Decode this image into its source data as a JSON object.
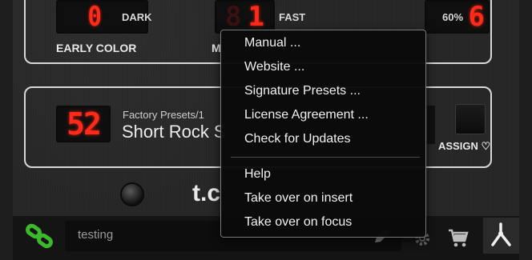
{
  "top_panel": {
    "early_color_digit": "0",
    "early_color_value": "DARK",
    "early_color_label": "EARLY COLOR",
    "mid_label_partial": "M",
    "speed_digit": "1",
    "speed_value": "FAST",
    "third_digit": "6",
    "third_value": "60%"
  },
  "preset_panel": {
    "preset_number": "52",
    "preset_path": "Factory Presets/1",
    "preset_name": "Short Rock S",
    "assign_label": "ASSIGN ♡"
  },
  "logo_text": "t.c",
  "bottom_bar": {
    "search_value": "testing"
  },
  "context_menu": {
    "items": [
      "Manual ...",
      "Website ...",
      "Signature Presets ...",
      "License Agreement ...",
      "Check for Updates",
      "Help",
      "Take over on insert",
      "Take over on focus"
    ]
  },
  "colors": {
    "led_red": "#ff2a1a",
    "link_green": "#3cb82c",
    "panel_border": "#d8d8d8",
    "menu_bg": "#0a0a0a"
  },
  "icons": [
    "link-icon",
    "pencil-icon",
    "gear-icon",
    "cart-icon",
    "tc-logo-icon",
    "knob-icon",
    "assign-button-icon"
  ]
}
